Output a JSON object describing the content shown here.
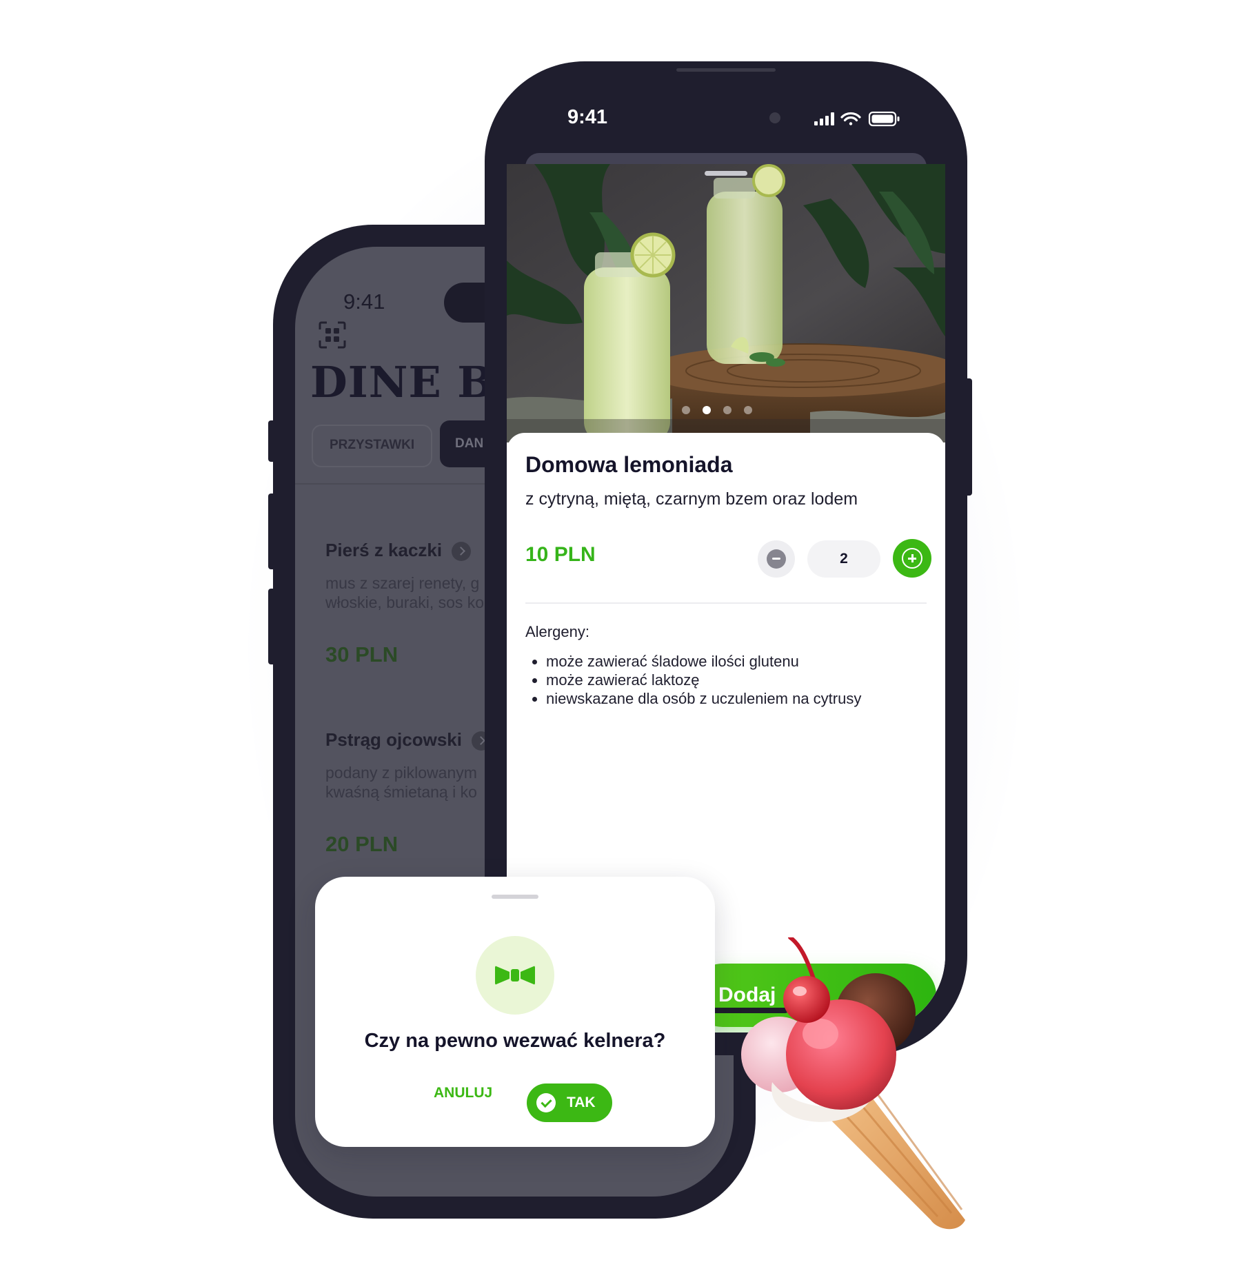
{
  "back_phone": {
    "status_time": "9:41",
    "restaurant_name": "DINE BIS",
    "tabs": [
      {
        "label": "PRZYSTAWKI"
      },
      {
        "label": "DAN"
      }
    ],
    "items": [
      {
        "name": "Pierś z kaczki",
        "desc_line1": "mus z szarej renety, g",
        "desc_line2": "włoskie, buraki, sos ko",
        "price": "30 PLN"
      },
      {
        "name": "Pstrąg ojcowski",
        "desc_line1": "podany z piklowanym",
        "desc_line2": "kwaśną śmietaną i ko",
        "price": "20 PLN"
      }
    ]
  },
  "front_phone": {
    "status_time": "9:41",
    "photo_icon": "lemonade-photo",
    "carousel_count": 4,
    "carousel_active_index": 1,
    "dish": {
      "title": "Domowa lemoniada",
      "subtitle": "z cytryną, miętą, czarnym bzem oraz lodem",
      "price": "10 PLN",
      "quantity": "2"
    },
    "allergens": {
      "title": "Alergeny:",
      "items": [
        "może zawierać śladowe ilości glutenu",
        "może zawierać laktozę",
        "niewskazane dla osób z uczuleniem na cytrusy"
      ]
    },
    "add_button_label": "Dodaj"
  },
  "modal": {
    "icon": "bow-tie-icon",
    "question": "Czy na pewno wezwać kelnera?",
    "cancel_label": "ANULUJ",
    "confirm_label": "TAK"
  },
  "colors": {
    "accent_green": "#3cb814",
    "phone_frame": "#1f1e2e",
    "ink": "#15142a"
  }
}
